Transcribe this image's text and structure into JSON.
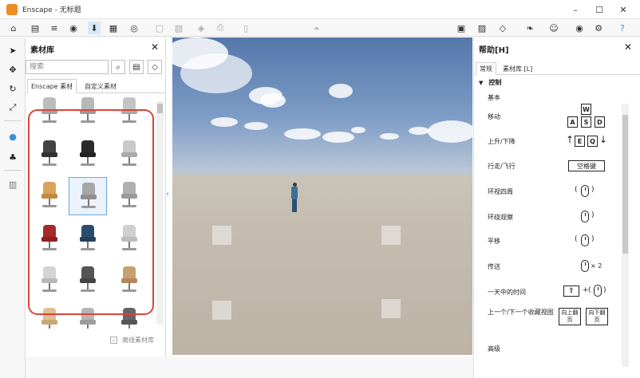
{
  "window": {
    "title": "Enscape - 无标题",
    "minimize": "–",
    "maximize": "☐",
    "close": "✕"
  },
  "toolbar": {
    "home_icon": "home-icon",
    "collapse_arrow": "^"
  },
  "library": {
    "title": "素材库",
    "close": "✕",
    "search_placeholder": "搜索",
    "tabs": [
      "Enscape 素材",
      "自定义素材"
    ],
    "offline_label": "离线素材库",
    "check": "✓",
    "collapse": "‹",
    "scroll_up": "^",
    "scroll_down": "⌄",
    "grid_rows": 6,
    "selected_cell": 7
  },
  "help": {
    "title": "帮助[H]",
    "close": "✕",
    "tabs": [
      "常规",
      "素材库 [L]"
    ],
    "section": "控制",
    "section_arrow": "▼",
    "group": "基本",
    "rows": [
      {
        "label": "移动"
      },
      {
        "label": "上升/下降"
      },
      {
        "label": "行走/飞行"
      },
      {
        "label": "环视四周"
      },
      {
        "label": "环绕观察"
      },
      {
        "label": "平移"
      },
      {
        "label": "传送"
      },
      {
        "label": "一天中的时间"
      },
      {
        "label": "上一个/下一个收藏视图"
      }
    ],
    "keys": {
      "w": "W",
      "a": "A",
      "s": "S",
      "d": "D",
      "e": "E",
      "q": "Q",
      "up_arrow": "↑",
      "down_arrow": "↓",
      "space": "空格键",
      "times2": "× 2",
      "plus": "+",
      "paren_open": "(",
      "paren_close": ")",
      "shift": "⇧",
      "page_up": "向上翻页",
      "page_down": "向下翻页"
    },
    "bottom_label": "高级"
  },
  "colors": {
    "accent": "#3a8fd8",
    "highlight": "#d8443a",
    "brand": "#f08a24"
  }
}
